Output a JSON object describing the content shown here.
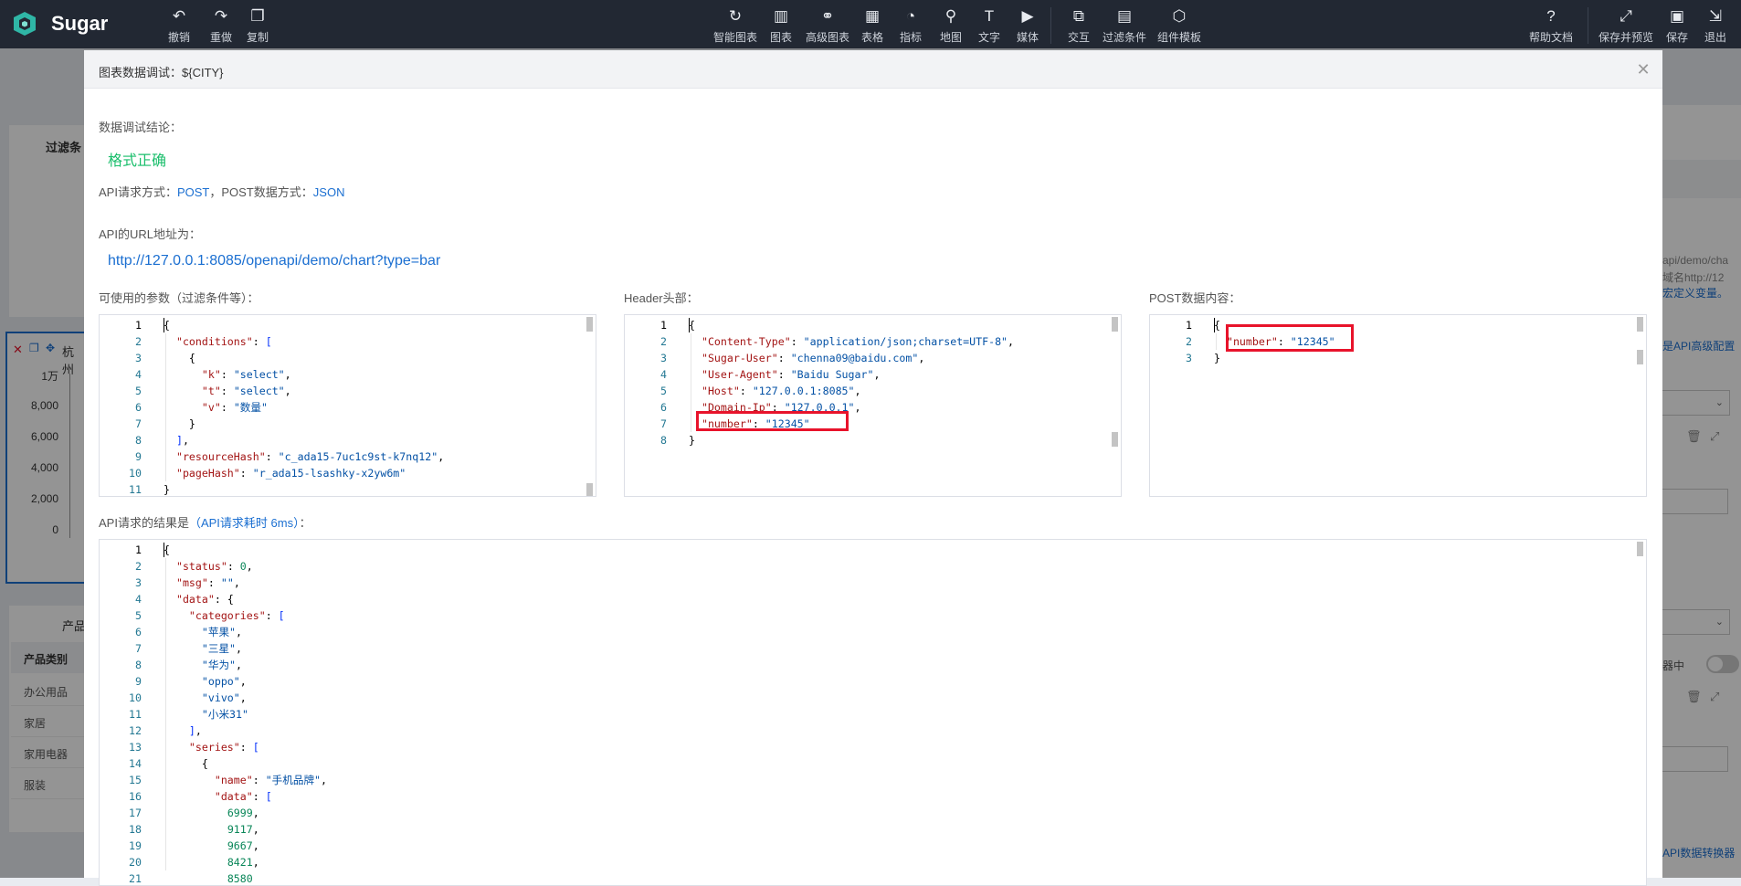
{
  "app": {
    "name": "Sugar"
  },
  "toolbar": {
    "left": [
      {
        "label": "撤销",
        "icon": "undo-icon",
        "glyph": "↶"
      },
      {
        "label": "重做",
        "icon": "redo-icon",
        "glyph": "↷"
      },
      {
        "label": "复制",
        "icon": "copy-icon",
        "glyph": "❐"
      }
    ],
    "center": [
      {
        "label": "智能图表",
        "icon": "smart-chart-icon",
        "glyph": "↻"
      },
      {
        "label": "图表",
        "icon": "bar-chart-icon",
        "glyph": "▥"
      },
      {
        "label": "高级图表",
        "icon": "advanced-chart-icon",
        "glyph": "⚭"
      },
      {
        "label": "表格",
        "icon": "table-icon",
        "glyph": "▦"
      },
      {
        "label": "指标",
        "icon": "gauge-icon",
        "glyph": "◔"
      },
      {
        "label": "地图",
        "icon": "map-pin-icon",
        "glyph": "⚲"
      },
      {
        "label": "文字",
        "icon": "text-icon",
        "glyph": "T"
      },
      {
        "label": "媒体",
        "icon": "media-icon",
        "glyph": "▶"
      },
      {
        "label": "交互",
        "icon": "interaction-icon",
        "glyph": "⧉"
      },
      {
        "label": "过滤条件",
        "icon": "filter-icon",
        "glyph": "▤"
      },
      {
        "label": "组件模板",
        "icon": "component-template-icon",
        "glyph": "⬡"
      }
    ],
    "right": [
      {
        "label": "帮助文档",
        "icon": "help-icon",
        "glyph": "?"
      },
      {
        "label": "保存并预览",
        "icon": "expand-icon",
        "glyph": "⤢"
      },
      {
        "label": "保存",
        "icon": "save-icon",
        "glyph": "▣"
      },
      {
        "label": "退出",
        "icon": "exit-icon",
        "glyph": "⇲"
      }
    ]
  },
  "background": {
    "filter_label": "过滤条",
    "chart_title": "杭州",
    "y_ticks": [
      "1万",
      "8,000",
      "6,000",
      "4,000",
      "2,000",
      "0"
    ],
    "table_title": "产品",
    "table_header": "产品类别",
    "table_rows": [
      "办公用品",
      "家居",
      "家用电器",
      "服装"
    ],
    "right_api_url_1": "api/demo/cha",
    "right_api_url_2": "域名http://12",
    "right_link_macro": "宏定义变量。",
    "right_link_api_advanced": "是API高级配置",
    "right_toggle_label": "器中",
    "right_link_converter": "API数据转换器"
  },
  "dialog": {
    "title": "图表数据调试：${CITY}",
    "conclusion_label": "数据调试结论：",
    "conclusion_value": "格式正确",
    "method_prefix": "API请求方式：",
    "method_value": "POST",
    "post_type_prefix": "，POST数据方式：",
    "post_type_value": "JSON",
    "url_label": "API的URL地址为：",
    "url_value": "http://127.0.0.1:8085/openapi/demo/chart?type=bar",
    "params_label": "可使用的参数（过滤条件等）：",
    "header_label": "Header头部：",
    "post_label": "POST数据内容：",
    "result_prefix": "API请求的结果是",
    "result_time": "（API请求耗时 6ms）",
    "result_suffix": "："
  },
  "editors": {
    "params": [
      [
        [
          "p",
          "{"
        ]
      ],
      [
        [
          "p",
          "  "
        ],
        [
          "k",
          "\"conditions\""
        ],
        [
          "p",
          ": "
        ],
        [
          "bk",
          "["
        ]
      ],
      [
        [
          "p",
          "    {"
        ]
      ],
      [
        [
          "p",
          "      "
        ],
        [
          "k",
          "\"k\""
        ],
        [
          "p",
          ": "
        ],
        [
          "s",
          "\"select\""
        ],
        [
          "p",
          ","
        ]
      ],
      [
        [
          "p",
          "      "
        ],
        [
          "k",
          "\"t\""
        ],
        [
          "p",
          ": "
        ],
        [
          "s",
          "\"select\""
        ],
        [
          "p",
          ","
        ]
      ],
      [
        [
          "p",
          "      "
        ],
        [
          "k",
          "\"v\""
        ],
        [
          "p",
          ": "
        ],
        [
          "s",
          "\"数量\""
        ]
      ],
      [
        [
          "p",
          "    }"
        ]
      ],
      [
        [
          "p",
          "  "
        ],
        [
          "bk",
          "]"
        ],
        [
          "p",
          ","
        ]
      ],
      [
        [
          "p",
          "  "
        ],
        [
          "k",
          "\"resourceHash\""
        ],
        [
          "p",
          ": "
        ],
        [
          "s",
          "\"c_ada15-7uc1c9st-k7nq12\""
        ],
        [
          "p",
          ","
        ]
      ],
      [
        [
          "p",
          "  "
        ],
        [
          "k",
          "\"pageHash\""
        ],
        [
          "p",
          ": "
        ],
        [
          "s",
          "\"r_ada15-lsashky-x2yw6m\""
        ]
      ],
      [
        [
          "p",
          "}"
        ]
      ]
    ],
    "header": [
      [
        [
          "p",
          "{"
        ]
      ],
      [
        [
          "p",
          "  "
        ],
        [
          "k",
          "\"Content-Type\""
        ],
        [
          "p",
          ": "
        ],
        [
          "s",
          "\"application/json;charset=UTF-8\""
        ],
        [
          "p",
          ","
        ]
      ],
      [
        [
          "p",
          "  "
        ],
        [
          "k",
          "\"Sugar-User\""
        ],
        [
          "p",
          ": "
        ],
        [
          "s",
          "\"chenna09@baidu.com\""
        ],
        [
          "p",
          ","
        ]
      ],
      [
        [
          "p",
          "  "
        ],
        [
          "k",
          "\"User-Agent\""
        ],
        [
          "p",
          ": "
        ],
        [
          "s",
          "\"Baidu Sugar\""
        ],
        [
          "p",
          ","
        ]
      ],
      [
        [
          "p",
          "  "
        ],
        [
          "k",
          "\"Host\""
        ],
        [
          "p",
          ": "
        ],
        [
          "s",
          "\"127.0.0.1:8085\""
        ],
        [
          "p",
          ","
        ]
      ],
      [
        [
          "p",
          "  "
        ],
        [
          "k",
          "\"Domain-Ip\""
        ],
        [
          "p",
          ": "
        ],
        [
          "s",
          "\"127.0.0.1\""
        ],
        [
          "p",
          ","
        ]
      ],
      [
        [
          "p",
          "  "
        ],
        [
          "k",
          "\"number\""
        ],
        [
          "p",
          ": "
        ],
        [
          "s",
          "\"12345\""
        ]
      ],
      [
        [
          "p",
          "}"
        ]
      ]
    ],
    "post": [
      [
        [
          "p",
          "{"
        ]
      ],
      [
        [
          "p",
          "  "
        ],
        [
          "k",
          "\"number\""
        ],
        [
          "p",
          ": "
        ],
        [
          "s",
          "\"12345\""
        ]
      ],
      [
        [
          "p",
          "}"
        ]
      ]
    ],
    "result": [
      [
        [
          "p",
          "{"
        ]
      ],
      [
        [
          "p",
          "  "
        ],
        [
          "k",
          "\"status\""
        ],
        [
          "p",
          ": "
        ],
        [
          "n",
          "0"
        ],
        [
          "p",
          ","
        ]
      ],
      [
        [
          "p",
          "  "
        ],
        [
          "k",
          "\"msg\""
        ],
        [
          "p",
          ": "
        ],
        [
          "s",
          "\"\""
        ],
        [
          "p",
          ","
        ]
      ],
      [
        [
          "p",
          "  "
        ],
        [
          "k",
          "\"data\""
        ],
        [
          "p",
          ": {"
        ]
      ],
      [
        [
          "p",
          "    "
        ],
        [
          "k",
          "\"categories\""
        ],
        [
          "p",
          ": "
        ],
        [
          "bk",
          "["
        ]
      ],
      [
        [
          "p",
          "      "
        ],
        [
          "s",
          "\"苹果\""
        ],
        [
          "p",
          ","
        ]
      ],
      [
        [
          "p",
          "      "
        ],
        [
          "s",
          "\"三星\""
        ],
        [
          "p",
          ","
        ]
      ],
      [
        [
          "p",
          "      "
        ],
        [
          "s",
          "\"华为\""
        ],
        [
          "p",
          ","
        ]
      ],
      [
        [
          "p",
          "      "
        ],
        [
          "s",
          "\"oppo\""
        ],
        [
          "p",
          ","
        ]
      ],
      [
        [
          "p",
          "      "
        ],
        [
          "s",
          "\"vivo\""
        ],
        [
          "p",
          ","
        ]
      ],
      [
        [
          "p",
          "      "
        ],
        [
          "s",
          "\"小米31\""
        ]
      ],
      [
        [
          "p",
          "    "
        ],
        [
          "bk",
          "]"
        ],
        [
          "p",
          ","
        ]
      ],
      [
        [
          "p",
          "    "
        ],
        [
          "k",
          "\"series\""
        ],
        [
          "p",
          ": "
        ],
        [
          "bk",
          "["
        ]
      ],
      [
        [
          "p",
          "      {"
        ]
      ],
      [
        [
          "p",
          "        "
        ],
        [
          "k",
          "\"name\""
        ],
        [
          "p",
          ": "
        ],
        [
          "s",
          "\"手机品牌\""
        ],
        [
          "p",
          ","
        ]
      ],
      [
        [
          "p",
          "        "
        ],
        [
          "k",
          "\"data\""
        ],
        [
          "p",
          ": "
        ],
        [
          "bk",
          "["
        ]
      ],
      [
        [
          "p",
          "          "
        ],
        [
          "n",
          "6999"
        ],
        [
          "p",
          ","
        ]
      ],
      [
        [
          "p",
          "          "
        ],
        [
          "n",
          "9117"
        ],
        [
          "p",
          ","
        ]
      ],
      [
        [
          "p",
          "          "
        ],
        [
          "n",
          "9667"
        ],
        [
          "p",
          ","
        ]
      ],
      [
        [
          "p",
          "          "
        ],
        [
          "n",
          "8421"
        ],
        [
          "p",
          ","
        ]
      ],
      [
        [
          "p",
          "          "
        ],
        [
          "n",
          "8580"
        ]
      ]
    ]
  }
}
